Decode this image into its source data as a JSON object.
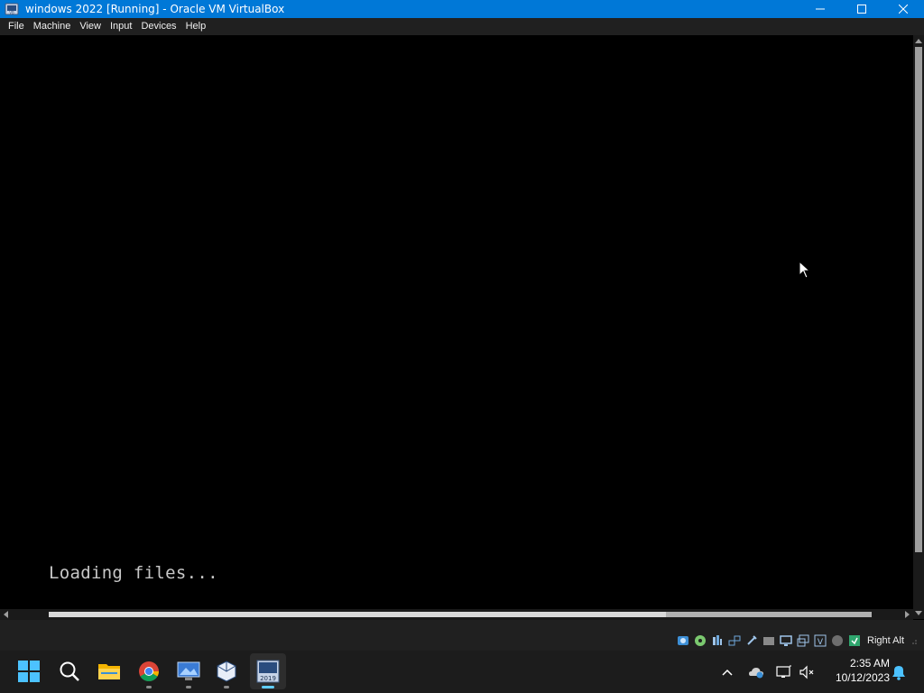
{
  "window": {
    "title": "windows 2022 [Running] - Oracle VM VirtualBox",
    "icon": "virtualbox-app-icon",
    "controls": [
      "minimize-icon",
      "maximize-icon",
      "close-icon"
    ]
  },
  "menu": {
    "items": [
      {
        "label": "File"
      },
      {
        "label": "Machine"
      },
      {
        "label": "View"
      },
      {
        "label": "Input"
      },
      {
        "label": "Devices"
      },
      {
        "label": "Help"
      }
    ]
  },
  "guest": {
    "console_text": "Loading files..."
  },
  "statusbar": {
    "icons": [
      "hard-disk-icon",
      "optical-drive-icon",
      "audio-icon",
      "network-icon",
      "usb-icon",
      "shared-folders-icon",
      "display-icon",
      "video-capture-icon",
      "virtualization-icon",
      "mouse-integration-icon",
      "keyboard-icon"
    ],
    "host_key": "Right Alt"
  },
  "taskbar": {
    "apps": [
      {
        "name": "start-button",
        "icon": "windows-logo-icon"
      },
      {
        "name": "search-button",
        "icon": "search-icon"
      },
      {
        "name": "file-explorer-app",
        "icon": "folder-icon"
      },
      {
        "name": "chrome-app",
        "icon": "chrome-icon"
      },
      {
        "name": "remote-desktop-app",
        "icon": "remote-desktop-icon"
      },
      {
        "name": "virtualbox-manager-app",
        "icon": "virtualbox-icon"
      },
      {
        "name": "virtualbox-vm-app",
        "icon": "vm-2019-icon",
        "badge": "2019"
      }
    ],
    "tray": {
      "icons": [
        "show-hidden-icons-chevron",
        "onedrive-icon",
        "network-icon",
        "volume-muted-icon",
        "notifications-bell-icon"
      ],
      "time": "2:35 AM",
      "date": "10/12/2023"
    }
  },
  "colors": {
    "titlebar": "#0078d7",
    "menubar": "#202020",
    "taskbar": "#1c1c1c",
    "accent": "#60cdff"
  }
}
